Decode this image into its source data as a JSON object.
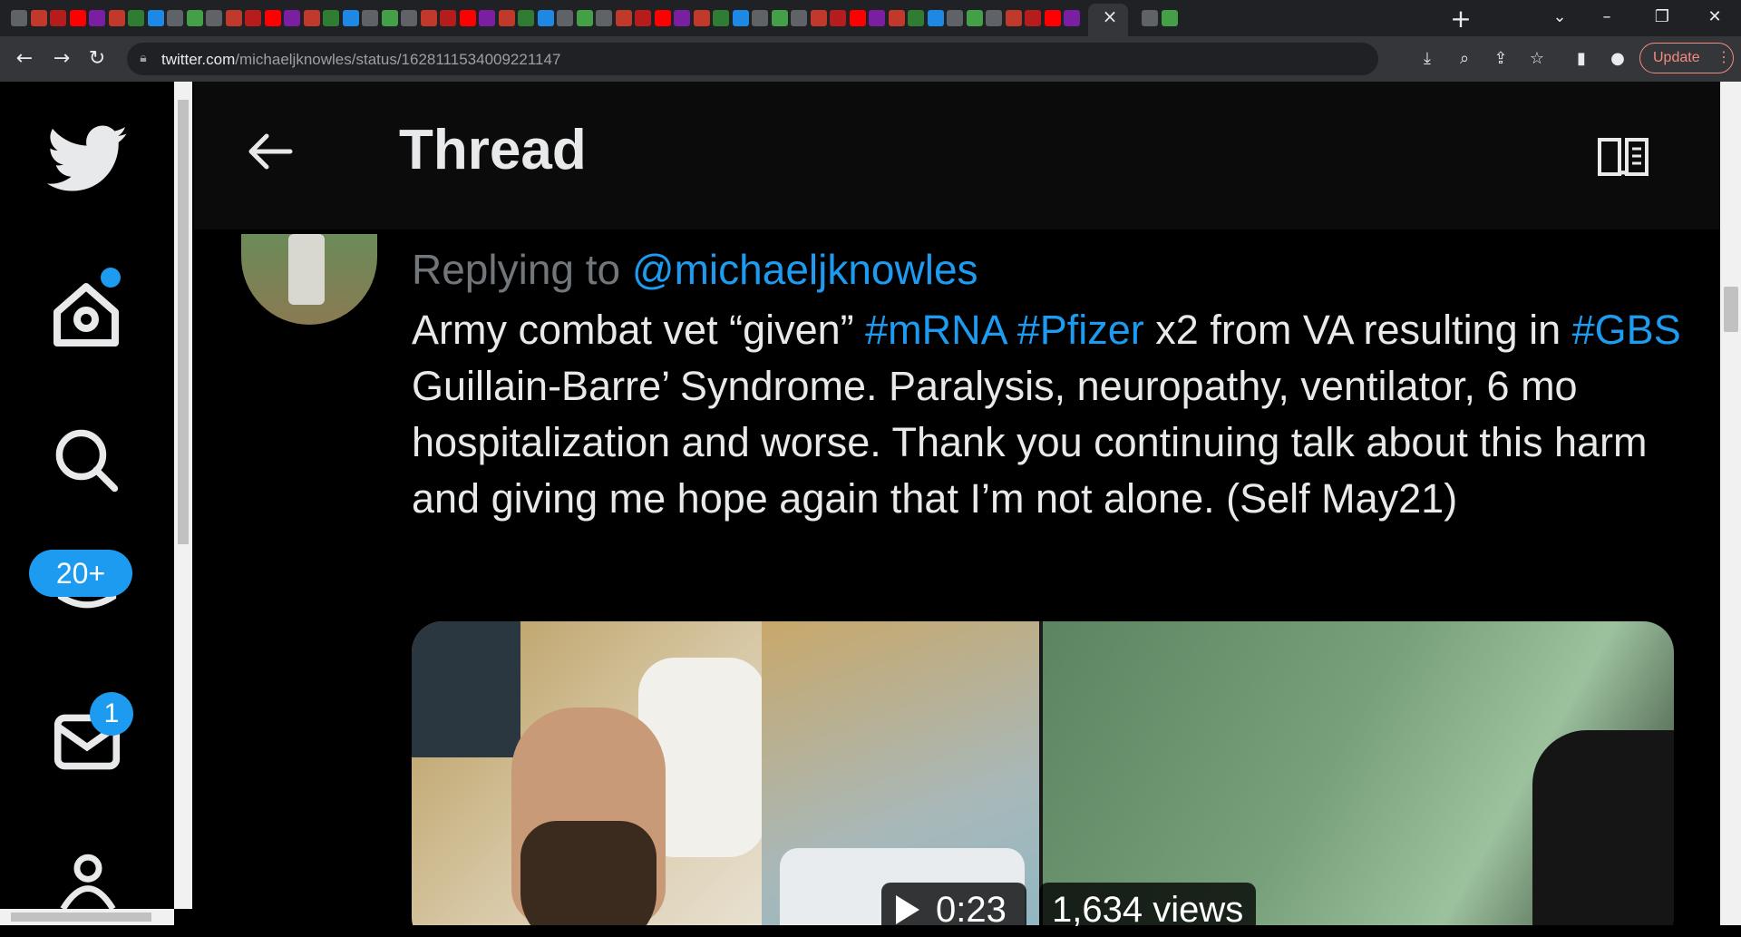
{
  "browser": {
    "url_domain": "twitter.com",
    "url_path": "/michaeljknowles/status/1628111534009221147",
    "update_label": "Update",
    "new_tab_label": "+",
    "close_tab_label": "×"
  },
  "sidebar": {
    "notifications_badge": "20+",
    "messages_badge": "1"
  },
  "header": {
    "title": "Thread"
  },
  "tweet": {
    "replying_prefix": "Replying to ",
    "replying_handle": "@michaeljknowles",
    "text_1": "Army combat vet “given” ",
    "hashtag_mrna": "#mRNA",
    "text_2": " ",
    "hashtag_pfizer": "#Pfizer",
    "text_3": " x2 from VA resulting in ",
    "hashtag_gbs": "#GBS",
    "text_4": " Guillain-Barre’ Syndrome. Paralysis, neuropathy, ventilator, 6 mo hospitalization and worse. Thank you continuing talk about this harm and  giving me hope again that I’m not alone. (Self May21)",
    "video_duration": "0:23",
    "video_views": "1,634 views"
  },
  "colors": {
    "accent": "#1d9bf0",
    "text": "#e7e9ea",
    "muted": "#71767b",
    "background": "#000000"
  }
}
